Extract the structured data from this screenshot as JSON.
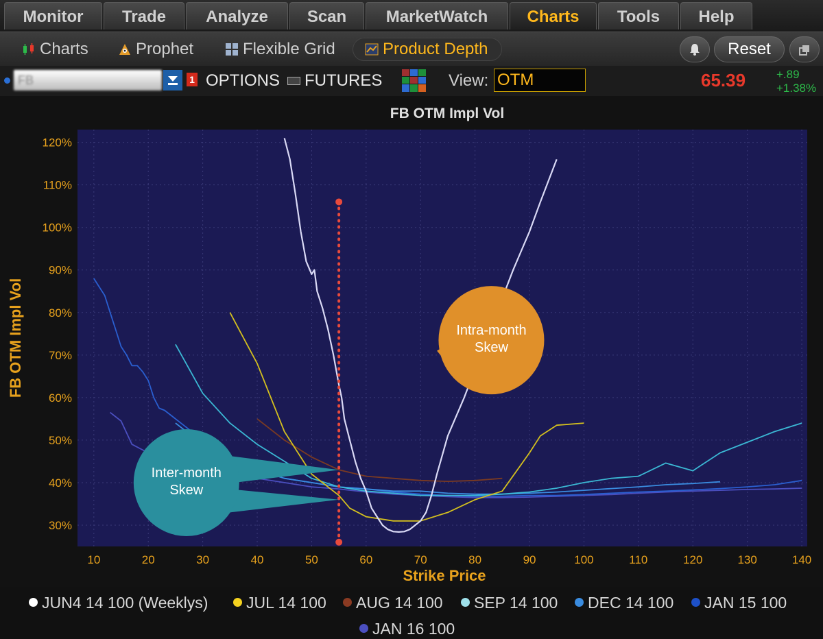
{
  "menu": {
    "tabs": [
      {
        "label": "Monitor"
      },
      {
        "label": "Trade"
      },
      {
        "label": "Analyze"
      },
      {
        "label": "Scan"
      },
      {
        "label": "MarketWatch"
      },
      {
        "label": "Charts"
      },
      {
        "label": "Tools"
      },
      {
        "label": "Help"
      }
    ],
    "active": "Charts"
  },
  "subbar": {
    "items": [
      {
        "label": "Charts",
        "icon": "candlestick-icon"
      },
      {
        "label": "Prophet",
        "icon": "prophet-icon"
      },
      {
        "label": "Flexible Grid",
        "icon": "grid-icon"
      },
      {
        "label": "Product Depth",
        "icon": "product-depth-icon"
      }
    ],
    "active": "Product Depth",
    "reset_label": "Reset",
    "bell_icon": "bell-icon",
    "detach_icon": "detach-icon"
  },
  "symbar": {
    "symbol": "FB",
    "link_badge": "1",
    "options_label": "OPTIONS",
    "futures_label": "FUTURES",
    "view_label": "View:",
    "view_value": "OTM",
    "last_price": "65.39",
    "net_change": "+.89",
    "pct_change": "+1.38%",
    "colors": {
      "price": "#e8392b",
      "change": "#2dbb4a"
    }
  },
  "chart_data": {
    "type": "line",
    "title": "FB OTM Impl Vol",
    "xlabel": "Strike Price",
    "ylabel": "FB OTM Impl Vol",
    "xlim": [
      7,
      141
    ],
    "ylim": [
      25,
      123
    ],
    "x_ticks": [
      10,
      20,
      30,
      40,
      50,
      60,
      70,
      80,
      90,
      100,
      110,
      120,
      130,
      140
    ],
    "y_ticks": [
      30,
      40,
      50,
      60,
      70,
      80,
      90,
      100,
      110,
      120
    ],
    "y_tick_suffix": "%",
    "grid": true,
    "legend_position": "bottom",
    "series": [
      {
        "name": "JUN4 14 100 (Weeklys)",
        "color": "#d9d9f5",
        "points": [
          [
            45,
            121
          ],
          [
            46,
            116
          ],
          [
            47,
            108
          ],
          [
            48,
            99
          ],
          [
            49,
            92
          ],
          [
            50,
            89
          ],
          [
            50.5,
            90
          ],
          [
            51,
            85
          ],
          [
            52,
            81
          ],
          [
            53,
            76
          ],
          [
            54,
            70
          ],
          [
            55,
            63
          ],
          [
            55.5,
            60
          ],
          [
            56,
            55
          ],
          [
            57,
            50
          ],
          [
            58,
            45
          ],
          [
            59,
            41
          ],
          [
            60,
            38
          ],
          [
            61,
            34
          ],
          [
            62,
            32
          ],
          [
            63,
            30
          ],
          [
            64,
            29
          ],
          [
            65,
            28.5
          ],
          [
            66,
            28.4
          ],
          [
            67,
            28.5
          ],
          [
            68,
            29
          ],
          [
            69,
            30
          ],
          [
            70,
            31
          ],
          [
            71,
            33
          ],
          [
            72,
            37
          ],
          [
            73,
            42
          ],
          [
            75,
            51
          ],
          [
            78,
            60
          ],
          [
            81,
            70
          ],
          [
            84,
            80
          ],
          [
            87,
            90
          ],
          [
            90,
            99
          ],
          [
            92,
            106
          ],
          [
            95,
            116
          ]
        ]
      },
      {
        "name": "JUL 14 100",
        "color": "#d4c01e",
        "points": [
          [
            35,
            80
          ],
          [
            40,
            68
          ],
          [
            45,
            52
          ],
          [
            50,
            42
          ],
          [
            55,
            37
          ],
          [
            57,
            34
          ],
          [
            60,
            32
          ],
          [
            65,
            31
          ],
          [
            70,
            31
          ],
          [
            75,
            33
          ],
          [
            80,
            36
          ],
          [
            85,
            38
          ],
          [
            90,
            47
          ],
          [
            92,
            51
          ],
          [
            95,
            53.5
          ],
          [
            100,
            54
          ]
        ]
      },
      {
        "name": "AUG 14 100",
        "color": "#7a3a22",
        "points": [
          [
            40,
            55
          ],
          [
            45,
            50
          ],
          [
            50,
            46
          ],
          [
            55,
            43
          ],
          [
            60,
            41.5
          ],
          [
            65,
            41
          ],
          [
            70,
            40.5
          ],
          [
            75,
            40.3
          ],
          [
            80,
            40.5
          ],
          [
            85,
            41
          ]
        ]
      },
      {
        "name": "SEP 14 100",
        "color": "#3bb8d4",
        "points": [
          [
            25,
            72.5
          ],
          [
            30,
            61
          ],
          [
            35,
            54
          ],
          [
            40,
            49
          ],
          [
            45,
            45
          ],
          [
            50,
            41
          ],
          [
            55,
            39
          ],
          [
            60,
            38
          ],
          [
            65,
            37.5
          ],
          [
            70,
            37
          ],
          [
            75,
            37
          ],
          [
            80,
            37
          ],
          [
            85,
            37.3
          ],
          [
            90,
            37.8
          ],
          [
            95,
            38.7
          ],
          [
            100,
            40
          ],
          [
            105,
            41
          ],
          [
            110,
            41.5
          ],
          [
            115,
            44.6
          ],
          [
            120,
            42.8
          ],
          [
            125,
            47
          ],
          [
            130,
            49.5
          ],
          [
            135,
            52
          ],
          [
            140,
            54
          ]
        ]
      },
      {
        "name": "DEC 14 100",
        "color": "#3a8ce0",
        "points": [
          [
            25,
            54
          ],
          [
            30,
            49
          ],
          [
            35,
            45
          ],
          [
            40,
            43
          ],
          [
            45,
            41
          ],
          [
            50,
            40
          ],
          [
            55,
            39
          ],
          [
            60,
            38.5
          ],
          [
            65,
            38
          ],
          [
            70,
            38
          ],
          [
            75,
            37.5
          ],
          [
            80,
            37.3
          ],
          [
            85,
            37.3
          ],
          [
            90,
            37.5
          ],
          [
            95,
            37.8
          ],
          [
            100,
            38.2
          ],
          [
            105,
            38.6
          ],
          [
            110,
            39
          ],
          [
            115,
            39.5
          ],
          [
            120,
            39.8
          ],
          [
            125,
            40.2
          ]
        ]
      },
      {
        "name": "JAN 15 100",
        "color": "#2a5fd0",
        "points": [
          [
            10,
            88
          ],
          [
            12,
            84
          ],
          [
            13,
            80
          ],
          [
            14,
            76
          ],
          [
            15,
            72
          ],
          [
            16,
            70
          ],
          [
            17,
            67.5
          ],
          [
            18,
            67.5
          ],
          [
            19,
            66
          ],
          [
            20,
            64
          ],
          [
            21,
            60
          ],
          [
            22,
            57.5
          ],
          [
            23,
            57
          ],
          [
            25,
            55
          ],
          [
            30,
            50
          ],
          [
            35,
            46
          ],
          [
            40,
            43
          ],
          [
            45,
            41
          ],
          [
            50,
            40
          ],
          [
            55,
            39
          ],
          [
            60,
            38.5
          ],
          [
            65,
            37.8
          ],
          [
            70,
            37.3
          ],
          [
            75,
            37
          ],
          [
            80,
            36.8
          ],
          [
            85,
            36.8
          ],
          [
            90,
            37
          ],
          [
            95,
            37
          ],
          [
            100,
            37.2
          ],
          [
            105,
            37.5
          ],
          [
            110,
            37.8
          ],
          [
            115,
            38
          ],
          [
            120,
            38.3
          ],
          [
            125,
            38.6
          ],
          [
            130,
            39
          ],
          [
            135,
            39.5
          ],
          [
            140,
            40.5
          ]
        ]
      },
      {
        "name": "JAN 16 100",
        "color": "#4b4fc0",
        "points": [
          [
            13,
            56.5
          ],
          [
            15,
            54.5
          ],
          [
            17,
            49
          ],
          [
            20,
            47
          ],
          [
            22,
            46
          ],
          [
            25,
            45.5
          ],
          [
            30,
            44
          ],
          [
            35,
            42.5
          ],
          [
            40,
            41
          ],
          [
            45,
            40
          ],
          [
            50,
            39
          ],
          [
            55,
            38.5
          ],
          [
            60,
            37.8
          ],
          [
            65,
            37.3
          ],
          [
            70,
            37
          ],
          [
            75,
            36.7
          ],
          [
            80,
            36.5
          ],
          [
            85,
            36.5
          ],
          [
            90,
            36.6
          ],
          [
            95,
            36.8
          ],
          [
            100,
            37
          ],
          [
            105,
            37.2
          ],
          [
            110,
            37.5
          ],
          [
            115,
            37.8
          ],
          [
            120,
            38
          ],
          [
            125,
            38.2
          ],
          [
            130,
            38.4
          ],
          [
            135,
            38.5
          ],
          [
            140,
            38.7
          ]
        ]
      }
    ],
    "annotations": [
      {
        "text": "Intra-month Skew",
        "lines": [
          "Intra-month",
          "Skew"
        ],
        "color": "#e0902a",
        "x": 83,
        "y": 73.5
      },
      {
        "text": "Inter-month Skew",
        "lines": [
          "Inter-month",
          "Skew"
        ],
        "color": "#2a8f9e",
        "x": 27,
        "y": 40
      },
      {
        "type": "vertical-dotted-line",
        "color": "#e84a3c",
        "x": 55,
        "y_from": 26,
        "y_to": 106
      }
    ],
    "colors": {
      "plot_bg": "#1b1a54",
      "axis_text": "#e8a21d",
      "grid": "#3b3a78"
    }
  }
}
